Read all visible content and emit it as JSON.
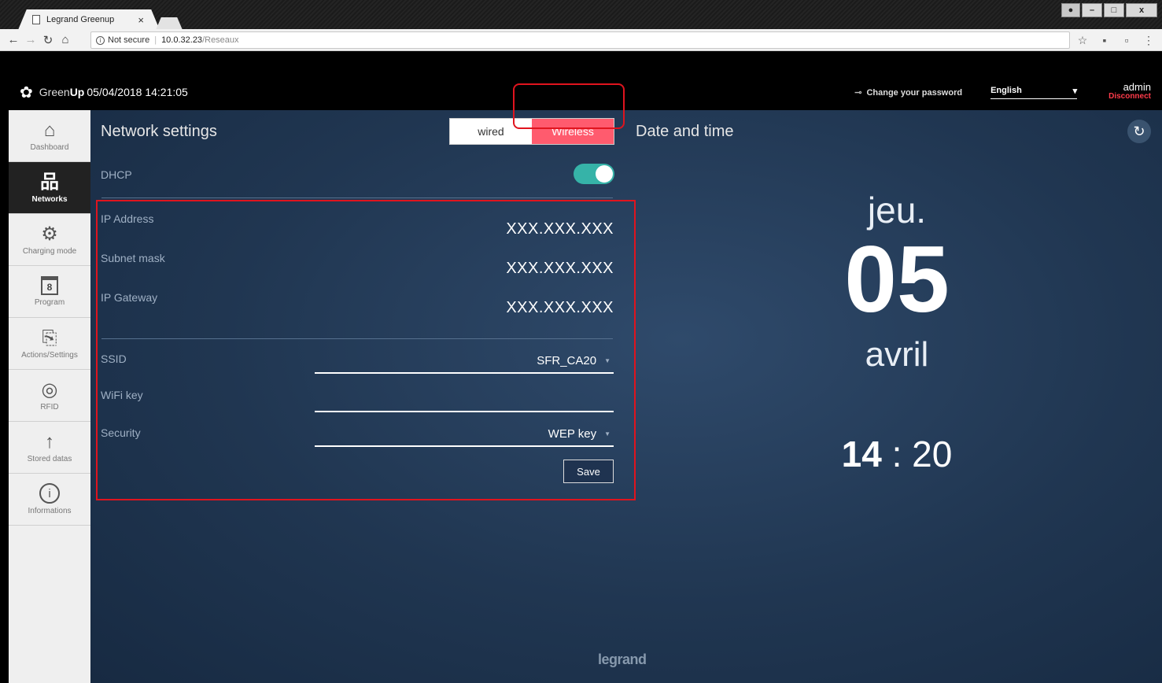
{
  "browser": {
    "tab_title": "Legrand Greenup",
    "tab_close": "×",
    "url_secure_label": "Not secure",
    "url_host": "10.0.32.23",
    "url_path": "/Reseaux",
    "window_close": "x"
  },
  "header": {
    "brand_light": "Green",
    "brand_bold": "Up",
    "datetime": "05/04/2018 14:21:05",
    "change_password": "Change your password",
    "language": "English",
    "username": "admin",
    "disconnect": "Disconnect"
  },
  "sidebar": {
    "items": [
      {
        "label": "Dashboard"
      },
      {
        "label": "Networks"
      },
      {
        "label": "Charging mode"
      },
      {
        "label": "Program",
        "icon_text": "8"
      },
      {
        "label": "Actions/Settings"
      },
      {
        "label": "RFID"
      },
      {
        "label": "Stored datas"
      },
      {
        "label": "Informations",
        "icon_text": "i"
      }
    ]
  },
  "network": {
    "title": "Network settings",
    "tab_wired": "wired",
    "tab_wireless": "Wireless",
    "dhcp_label": "DHCP",
    "dhcp_on": true,
    "ip_label": "IP Address",
    "ip_value": "XXX.XXX.XXX",
    "subnet_label": "Subnet mask",
    "subnet_value": "XXX.XXX.XXX",
    "gateway_label": "IP Gateway",
    "gateway_value": "XXX.XXX.XXX",
    "ssid_label": "SSID",
    "ssid_value": "SFR_CA20",
    "wifi_key_label": "WiFi key",
    "wifi_key_value": "",
    "security_label": "Security",
    "security_value": "WEP key",
    "save_label": "Save"
  },
  "datetime_panel": {
    "title": "Date and time",
    "day_name": "jeu.",
    "day_number": "05",
    "month": "avril",
    "hour": "14",
    "colon": ":",
    "minute": "20"
  },
  "footer": {
    "logo": "legrand"
  },
  "colors": {
    "accent": "#ff5b6e",
    "toggle_on": "#36b3a8",
    "highlight": "#e0141e",
    "disconnect": "#ff3b4a"
  }
}
